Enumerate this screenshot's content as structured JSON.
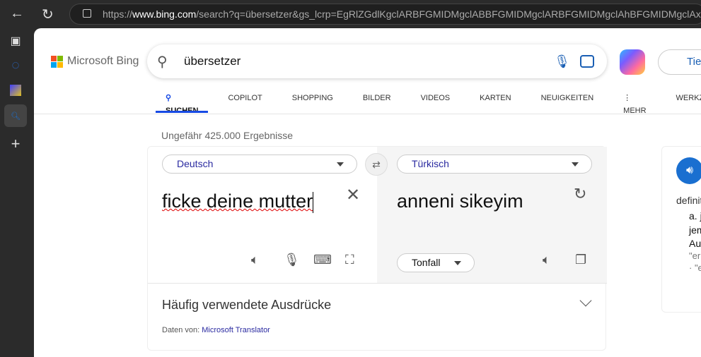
{
  "browser": {
    "url_prefix": "https://",
    "url_host": "www.bing.com",
    "url_rest": "/search?q=übersetzer&gs_lcrp=EgRlZGdlKgclARBFGMIDMgclABBFGMIDMgclARBFGMIDMgclAhBFGMIDMgclAxBFGMIDMgcl"
  },
  "logo": "Microsoft Bing",
  "search": {
    "query": "übersetzer"
  },
  "deep_search": "Tie",
  "tabs": [
    {
      "label": "SUCHEN"
    },
    {
      "label": "COPILOT"
    },
    {
      "label": "SHOPPING"
    },
    {
      "label": "BILDER"
    },
    {
      "label": "VIDEOS"
    },
    {
      "label": "KARTEN"
    },
    {
      "label": "NEUIGKEITEN"
    },
    {
      "label": "⋮ MEHR"
    },
    {
      "label": "WERKZEU"
    }
  ],
  "results_count": "Ungefähr 425.000 Ergebnisse",
  "translator": {
    "source_lang": "Deutsch",
    "target_lang": "Türkisch",
    "source_text": "ficke deine mutter",
    "target_text": "anneni sikeyim",
    "tone": "Tonfall",
    "common_phrases": "Häufig verwendete Ausdrücke",
    "data_from": "Daten von:",
    "provider": "Microsoft Translator"
  },
  "dictionary": {
    "l1": "definit",
    "l2": "a. j",
    "l3": "jem",
    "l4": "Au",
    "l5": "\"er",
    "l6": "· \"e"
  },
  "colors": {
    "accent": "#174ae4",
    "link": "#2a2aa0"
  }
}
